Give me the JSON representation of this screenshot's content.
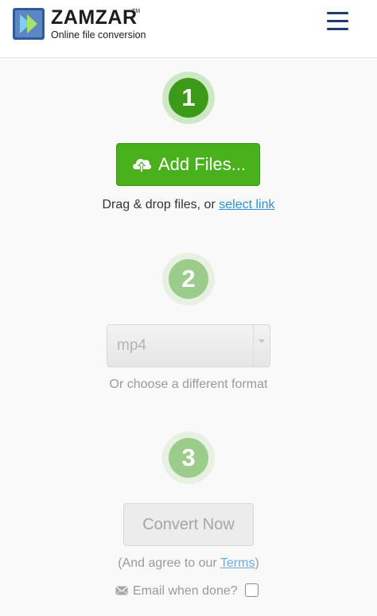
{
  "header": {
    "brand": "ZAMZAR",
    "trademark": "TM",
    "tagline": "Online file conversion",
    "logo_icon": "zamzar-arrows-icon",
    "menu_icon": "hamburger-menu-icon",
    "brand_color": "#1f3d73"
  },
  "steps": {
    "step1": {
      "number": "1",
      "state": "active"
    },
    "step2": {
      "number": "2",
      "state": "idle"
    },
    "step3": {
      "number": "3",
      "state": "idle"
    }
  },
  "upload": {
    "button_label": "Add Files...",
    "button_icon": "cloud-upload-icon",
    "drop_text": "Drag & drop files, or ",
    "link_text": "select link",
    "button_color": "#48b11c"
  },
  "format": {
    "selected": "mp4",
    "hint": "Or choose a different format"
  },
  "convert": {
    "button_label": "Convert Now",
    "agree_prefix": "(And agree to our ",
    "terms_link": "Terms",
    "agree_suffix": ")",
    "email_label": "Email when done?",
    "email_icon": "envelope-icon",
    "email_checked": false
  }
}
